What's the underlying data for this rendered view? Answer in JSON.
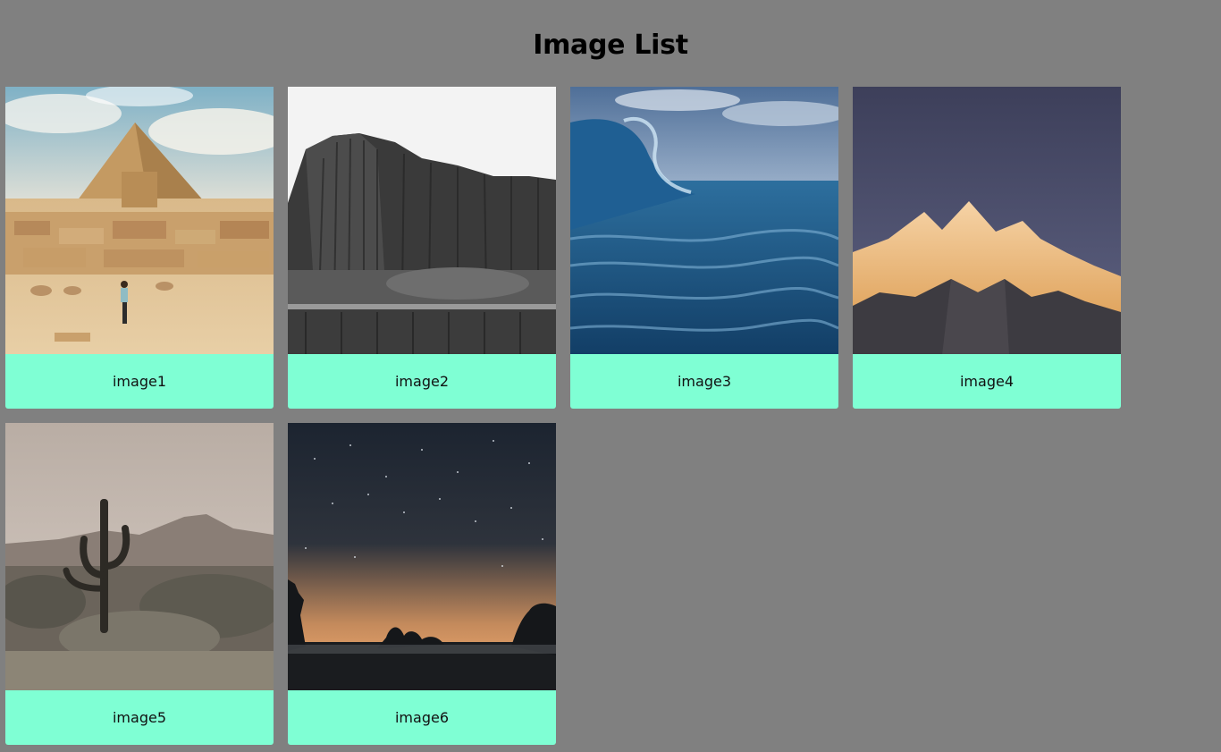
{
  "page": {
    "title": "Image List",
    "background": "#808080",
    "accent": "#7fffd4"
  },
  "images": [
    {
      "label": "image1",
      "scene": "pyramid-desert"
    },
    {
      "label": "image2",
      "scene": "basalt-cliff"
    },
    {
      "label": "image3",
      "scene": "ocean-wave"
    },
    {
      "label": "image4",
      "scene": "sunlit-mountain"
    },
    {
      "label": "image5",
      "scene": "cactus-desert"
    },
    {
      "label": "image6",
      "scene": "night-sky-forest"
    }
  ]
}
